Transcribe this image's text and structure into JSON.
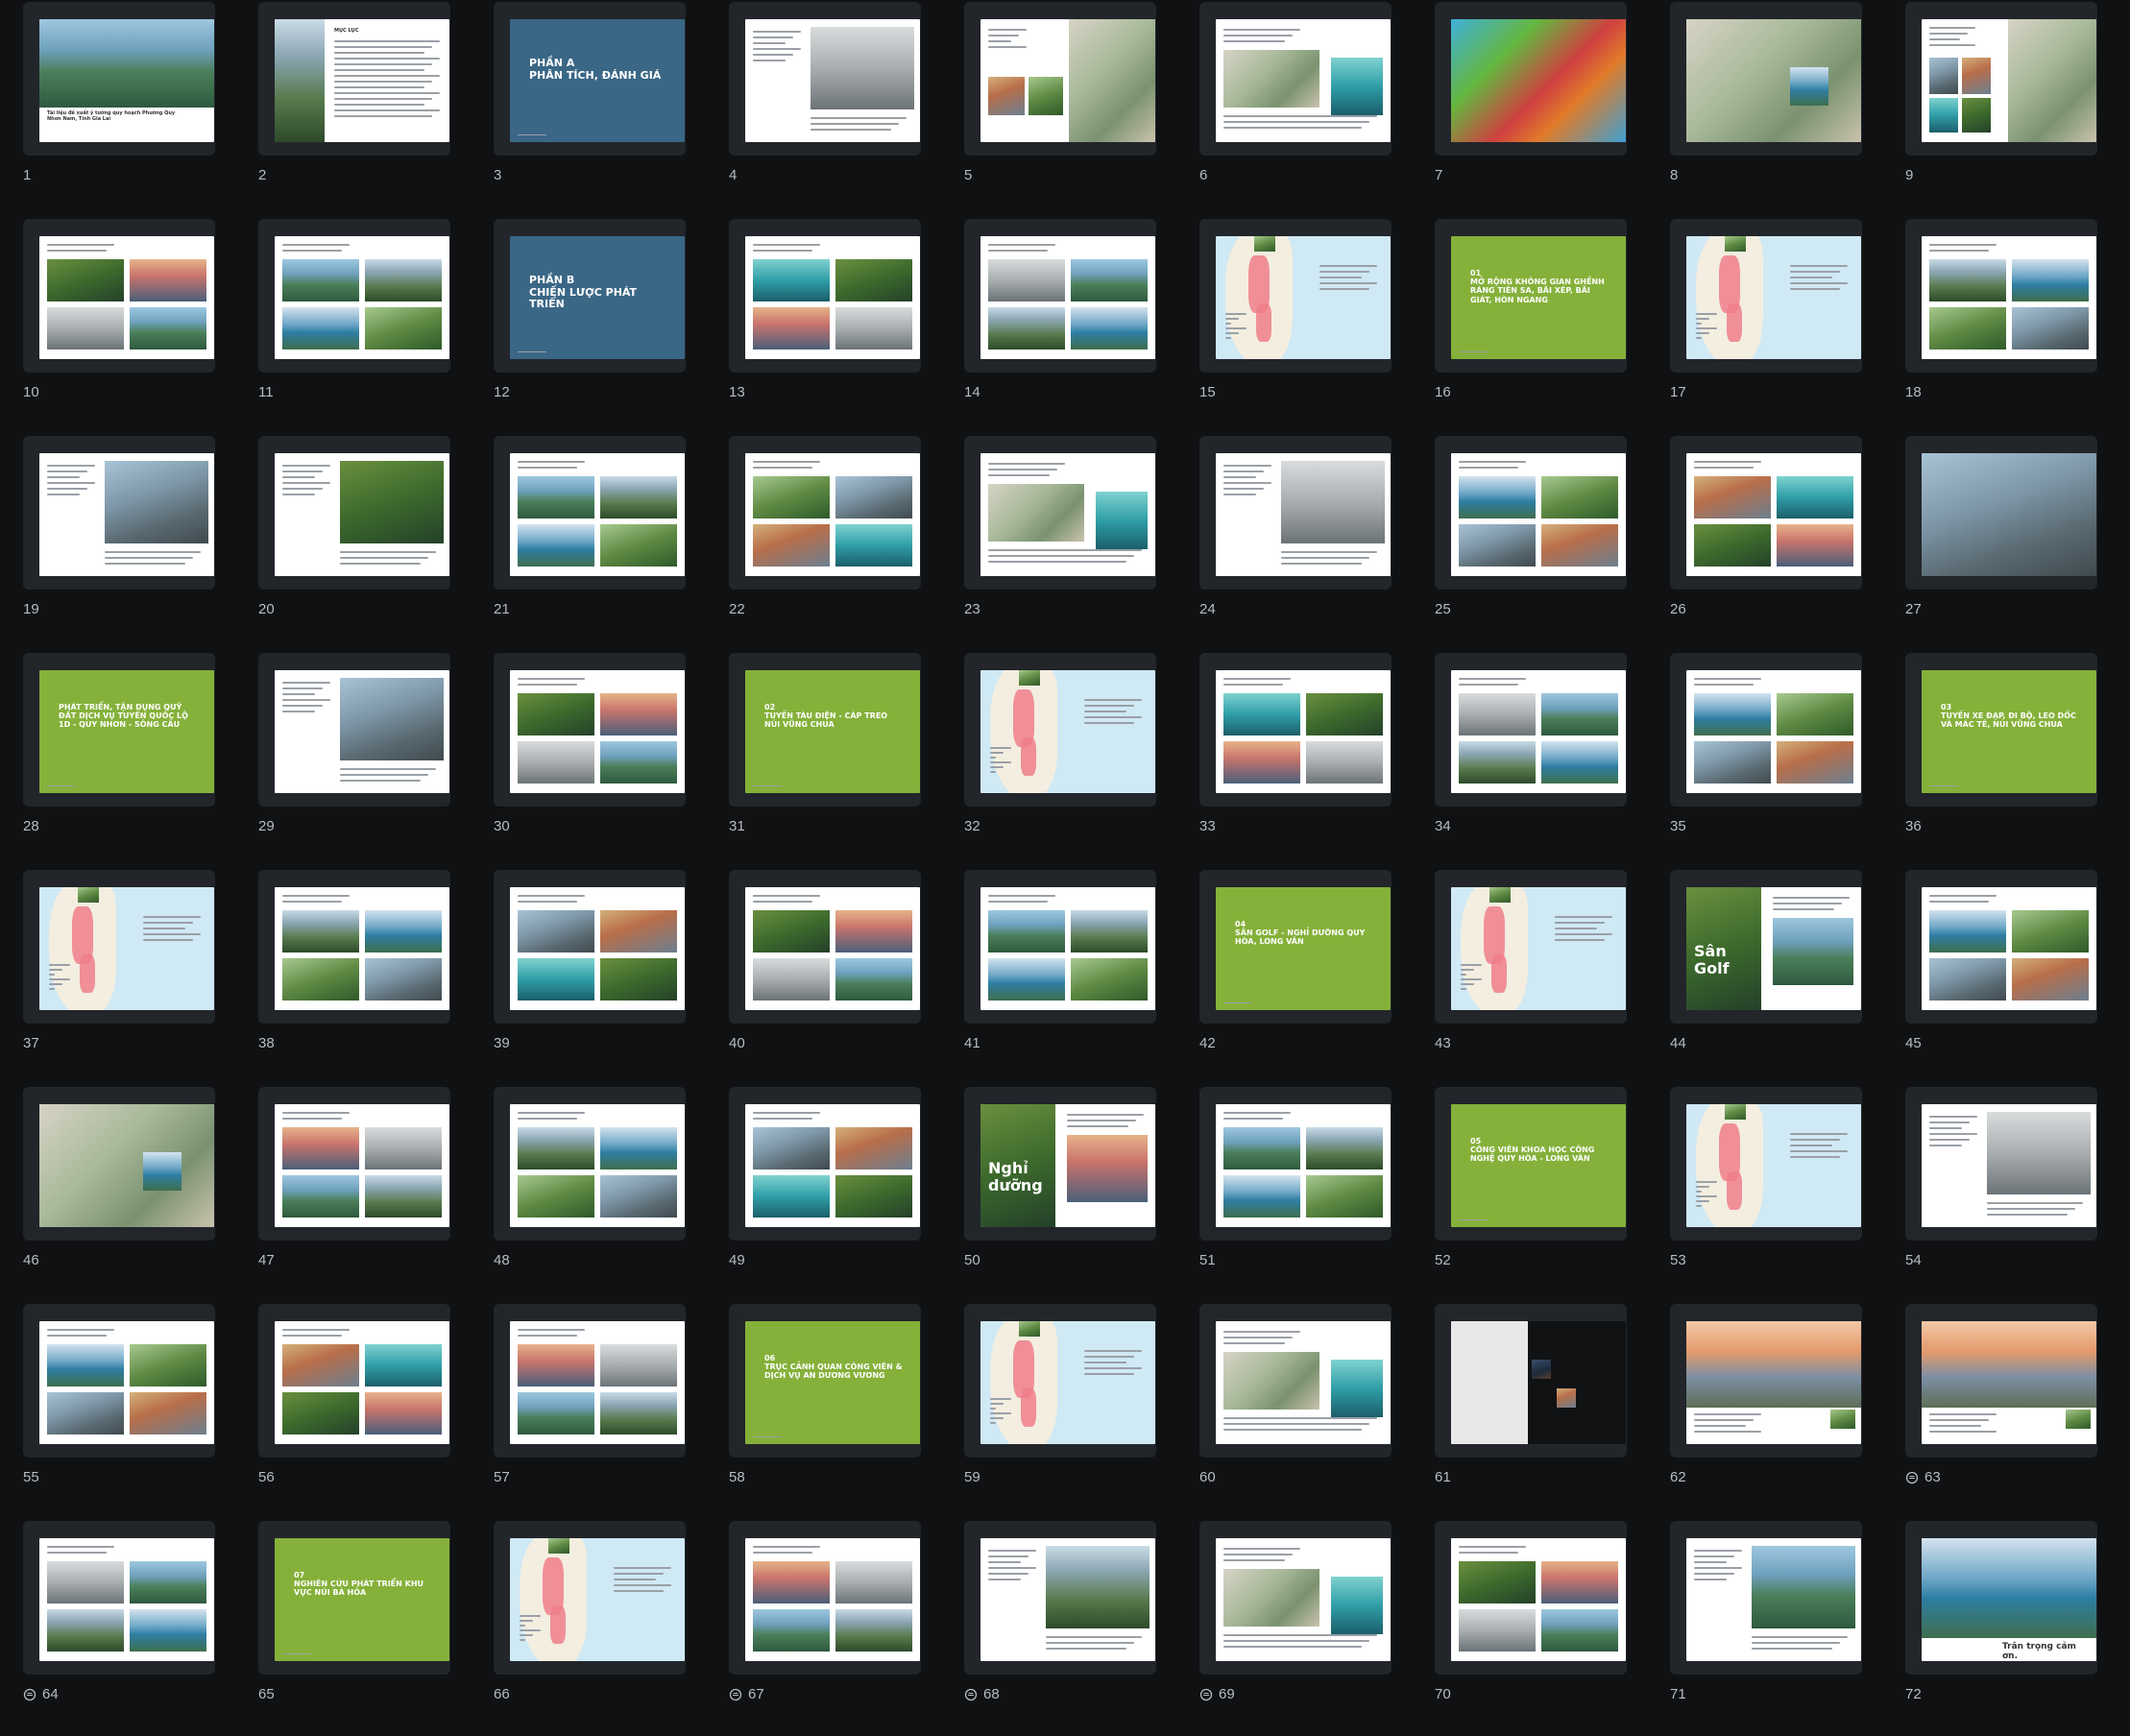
{
  "colors": {
    "background": "#0f1113",
    "frame": "#22252a",
    "section_blue": "#3a6786",
    "section_green": "#85b13a",
    "map_sea": "#cfe9f5",
    "label": "#b9bcc2"
  },
  "pages": [
    {
      "n": "1",
      "style": "cover",
      "title": "Tài liệu đề xuất ý tưởng quy hoạch Phường Quy Nhơn Nam, Tỉnh Gia Lai",
      "comment": false
    },
    {
      "n": "2",
      "style": "toc",
      "title": "MỤC LỤC",
      "comment": false
    },
    {
      "n": "3",
      "style": "blue",
      "title": "PHẦN A\nPHÂN TÍCH, ĐÁNH GIÁ",
      "comment": false
    },
    {
      "n": "4",
      "style": "photo-text",
      "title": "Tổng quan Phường Quy Nhơn Nam",
      "comment": false
    },
    {
      "n": "5",
      "style": "map-doc",
      "title": "",
      "comment": false
    },
    {
      "n": "6",
      "style": "chart-doc",
      "title": "",
      "comment": false
    },
    {
      "n": "7",
      "style": "rainmap",
      "title": "",
      "comment": false
    },
    {
      "n": "8",
      "style": "satmap",
      "title": "",
      "comment": false
    },
    {
      "n": "9",
      "style": "photos-map",
      "title": "",
      "comment": false
    },
    {
      "n": "10",
      "style": "photos",
      "title": "",
      "comment": false
    },
    {
      "n": "11",
      "style": "photos",
      "title": "",
      "comment": false
    },
    {
      "n": "12",
      "style": "blue",
      "title": "PHẦN B\nCHIẾN LƯỢC PHÁT TRIỂN",
      "comment": false
    },
    {
      "n": "13",
      "style": "photos",
      "title": "",
      "comment": false
    },
    {
      "n": "14",
      "style": "photos",
      "title": "",
      "comment": false
    },
    {
      "n": "15",
      "style": "map",
      "title": "",
      "comment": false
    },
    {
      "n": "16",
      "style": "green",
      "title": "01\nMỞ RỘNG KHÔNG GIAN GHỀNH RÁNG TIÊN SA, BÃI XÉP, BÃI GIÁT, HÒN NGANG",
      "comment": false
    },
    {
      "n": "17",
      "style": "map",
      "title": "",
      "comment": false
    },
    {
      "n": "18",
      "style": "photos",
      "title": "",
      "comment": false
    },
    {
      "n": "19",
      "style": "photo-text",
      "title": "",
      "comment": false
    },
    {
      "n": "20",
      "style": "photo-text",
      "title": "",
      "comment": false
    },
    {
      "n": "21",
      "style": "photos",
      "title": "",
      "comment": false
    },
    {
      "n": "22",
      "style": "photos",
      "title": "",
      "comment": false
    },
    {
      "n": "23",
      "style": "chart-doc",
      "title": "",
      "comment": false
    },
    {
      "n": "24",
      "style": "photo-text",
      "title": "",
      "comment": false
    },
    {
      "n": "25",
      "style": "photos",
      "title": "",
      "comment": false
    },
    {
      "n": "26",
      "style": "photos",
      "title": "",
      "comment": false
    },
    {
      "n": "27",
      "style": "fullphoto",
      "title": "",
      "comment": false
    },
    {
      "n": "28",
      "style": "green",
      "title": "PHÁT TRIỂN, TẬN DỤNG QUỸ ĐẤT DỊCH VỤ TUYẾN QUỐC LỘ 1D - QUY NHƠN - SÔNG CẦU",
      "comment": false
    },
    {
      "n": "29",
      "style": "photo-text",
      "title": "",
      "comment": false
    },
    {
      "n": "30",
      "style": "photos",
      "title": "",
      "comment": false
    },
    {
      "n": "31",
      "style": "green",
      "title": "02\nTUYẾN TÀU ĐIỆN - CÁP TREO NÚI VŨNG CHUA",
      "comment": false
    },
    {
      "n": "32",
      "style": "map",
      "title": "",
      "comment": false
    },
    {
      "n": "33",
      "style": "photos",
      "title": "",
      "comment": false
    },
    {
      "n": "34",
      "style": "photos",
      "title": "",
      "comment": false
    },
    {
      "n": "35",
      "style": "photos",
      "title": "",
      "comment": false
    },
    {
      "n": "36",
      "style": "green",
      "title": "03\nTUYẾN XE ĐẠP, ĐI BỘ, LEO DỐC VÀ MÁC TÊ, NÚI VŨNG CHUA",
      "comment": false
    },
    {
      "n": "37",
      "style": "map",
      "title": "",
      "comment": false
    },
    {
      "n": "38",
      "style": "photos",
      "title": "",
      "comment": false
    },
    {
      "n": "39",
      "style": "photos",
      "title": "",
      "comment": false
    },
    {
      "n": "40",
      "style": "photos",
      "title": "",
      "comment": false
    },
    {
      "n": "41",
      "style": "photos",
      "title": "",
      "comment": false
    },
    {
      "n": "42",
      "style": "green",
      "title": "04\nSÂN GOLF - NGHỈ DƯỠNG QUY HÒA, LONG VÂN",
      "comment": false
    },
    {
      "n": "43",
      "style": "map",
      "title": "",
      "comment": false
    },
    {
      "n": "44",
      "style": "golf",
      "title": "Sân Golf",
      "comment": false
    },
    {
      "n": "45",
      "style": "photos",
      "title": "",
      "comment": false
    },
    {
      "n": "46",
      "style": "satmap",
      "title": "",
      "comment": false
    },
    {
      "n": "47",
      "style": "photos",
      "title": "",
      "comment": false
    },
    {
      "n": "48",
      "style": "photos",
      "title": "",
      "comment": false
    },
    {
      "n": "49",
      "style": "photos",
      "title": "",
      "comment": false
    },
    {
      "n": "50",
      "style": "golf",
      "title": "Nghỉ dưỡng",
      "comment": false
    },
    {
      "n": "51",
      "style": "photos",
      "title": "",
      "comment": false
    },
    {
      "n": "52",
      "style": "green",
      "title": "05\nCÔNG VIÊN KHOA HỌC CÔNG NGHỆ QUY HÒA - LONG VÂN",
      "comment": false
    },
    {
      "n": "53",
      "style": "map",
      "title": "",
      "comment": false
    },
    {
      "n": "54",
      "style": "photo-text",
      "title": "",
      "comment": false
    },
    {
      "n": "55",
      "style": "photos",
      "title": "",
      "comment": false
    },
    {
      "n": "56",
      "style": "photos",
      "title": "",
      "comment": false
    },
    {
      "n": "57",
      "style": "photos",
      "title": "",
      "comment": false
    },
    {
      "n": "58",
      "style": "green",
      "title": "06\nTRỤC CẢNH QUAN CÔNG VIÊN & DỊCH VỤ AN DƯƠNG VƯƠNG",
      "comment": false
    },
    {
      "n": "59",
      "style": "map",
      "title": "",
      "comment": false
    },
    {
      "n": "60",
      "style": "chart-doc",
      "title": "",
      "comment": false
    },
    {
      "n": "61",
      "style": "dark",
      "title": "",
      "comment": false
    },
    {
      "n": "62",
      "style": "ferris",
      "title": "",
      "comment": false
    },
    {
      "n": "63",
      "style": "ferris",
      "title": "",
      "comment": true
    },
    {
      "n": "64",
      "style": "photos",
      "title": "",
      "comment": true
    },
    {
      "n": "65",
      "style": "green",
      "title": "07\nNGHIÊN CỨU PHÁT TRIỂN KHU VỰC NÚI BÀ HỎA",
      "comment": false
    },
    {
      "n": "66",
      "style": "map",
      "title": "",
      "comment": false
    },
    {
      "n": "67",
      "style": "photos",
      "title": "",
      "comment": true
    },
    {
      "n": "68",
      "style": "photo-text",
      "title": "",
      "comment": true
    },
    {
      "n": "69",
      "style": "chart-doc",
      "title": "",
      "comment": true
    },
    {
      "n": "70",
      "style": "photos",
      "title": "",
      "comment": false
    },
    {
      "n": "71",
      "style": "photo-text",
      "title": "",
      "comment": false
    },
    {
      "n": "72",
      "style": "cover-end",
      "title": "Trân trọng cảm ơn.",
      "comment": false
    }
  ]
}
